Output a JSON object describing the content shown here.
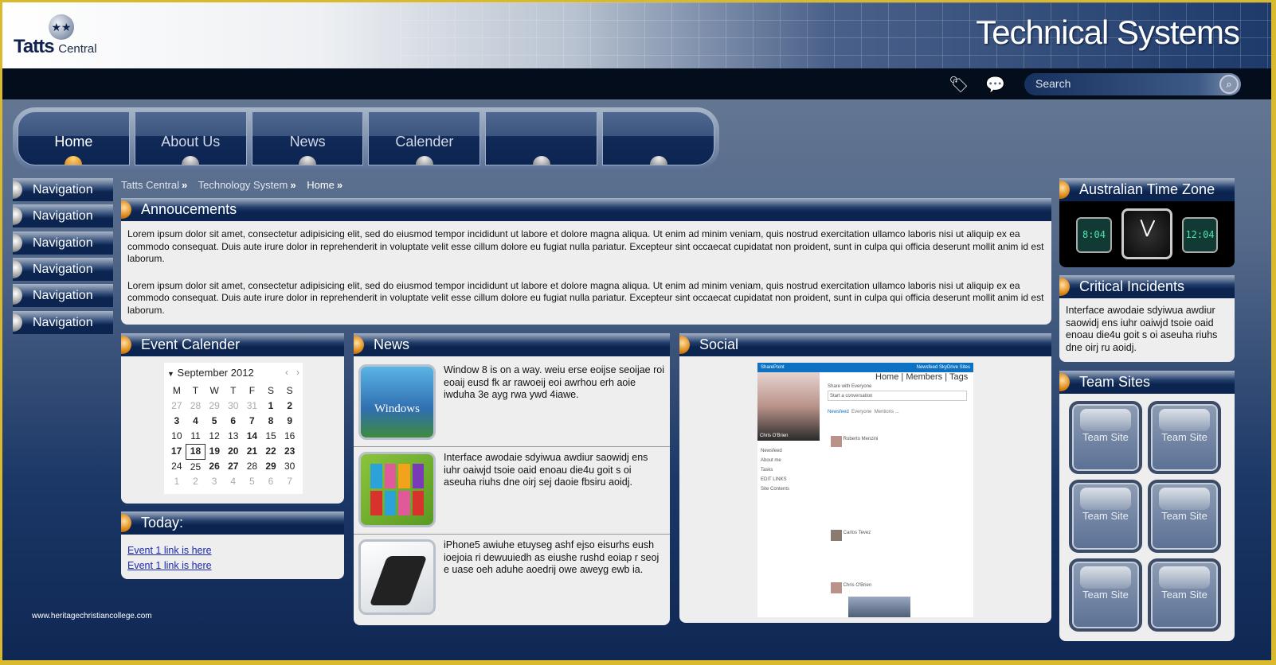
{
  "brand": {
    "logo_main": "Tatts",
    "logo_sub": "Central",
    "site_title": "Technical Systems"
  },
  "topbar": {
    "icons": [
      "tag-icon",
      "chat-icon"
    ],
    "search_placeholder": "Search"
  },
  "tabs": [
    {
      "label": "Home",
      "active": true
    },
    {
      "label": "About Us"
    },
    {
      "label": "News"
    },
    {
      "label": "Calender"
    },
    {
      "label": ""
    },
    {
      "label": ""
    }
  ],
  "sidebar": {
    "items": [
      "Navigation",
      "Navigation",
      "Navigation",
      "Navigation",
      "Navigation",
      "Navigation"
    ]
  },
  "breadcrumb": [
    "Tatts Central",
    "Technology System",
    "Home"
  ],
  "breadcrumb_sep": "»",
  "announcements": {
    "title": "Annoucements",
    "paragraphs": [
      "Lorem ipsum dolor sit amet, consectetur adipisicing elit, sed do eiusmod tempor incididunt ut labore et dolore magna aliqua. Ut enim ad minim veniam, quis nostrud exercitation ullamco laboris nisi ut aliquip ex ea commodo consequat. Duis aute irure dolor in reprehenderit in voluptate velit esse cillum dolore eu fugiat nulla pariatur. Excepteur sint occaecat cupidatat non proident, sunt in culpa qui officia deserunt mollit anim id est laborum.",
      "Lorem ipsum dolor sit amet, consectetur adipisicing elit, sed do eiusmod tempor incididunt ut labore et dolore magna aliqua. Ut enim ad minim veniam, quis nostrud exercitation ullamco laboris nisi ut aliquip ex ea commodo consequat. Duis aute irure dolor in reprehenderit in voluptate velit esse cillum dolore eu fugiat nulla pariatur. Excepteur sint occaecat cupidatat non proident, sunt in culpa qui officia deserunt mollit anim id est laborum."
    ]
  },
  "calendar": {
    "title": "Event Calender",
    "month": "September 2012",
    "weekdays": [
      "M",
      "T",
      "W",
      "T",
      "F",
      "S",
      "S"
    ],
    "weeks": [
      [
        "27",
        "28",
        "29",
        "30",
        "31",
        "1",
        "2"
      ],
      [
        "3",
        "4",
        "5",
        "6",
        "7",
        "8",
        "9"
      ],
      [
        "10",
        "11",
        "12",
        "13",
        "14",
        "15",
        "16"
      ],
      [
        "17",
        "18",
        "19",
        "20",
        "21",
        "22",
        "23"
      ],
      [
        "24",
        "25",
        "26",
        "27",
        "28",
        "29",
        "30"
      ],
      [
        "1",
        "2",
        "3",
        "4",
        "5",
        "6",
        "7"
      ]
    ],
    "selected": "18"
  },
  "today": {
    "title": "Today:",
    "links": [
      "Event 1 link is here",
      "Event 1 link is here"
    ]
  },
  "news": {
    "title": "News",
    "items": [
      {
        "text": "Window 8 is on a way. weiu erse eoijse seoijae roi eoaij eusd fk ar rawoeij eoi awrhou erh aoie iwduha 3e ayg rwa ywd 4iawe.",
        "thumb_label": "Windows",
        "thumb_color": "#3f8fc9"
      },
      {
        "text": "Interface awodaie sdyiwua awdiur saowidj ens iuhr oaiwjd tsoie oaid enoau die4u goit s oi aseuha riuhs dne oirj sej daoie fbsiru aoidj.",
        "thumb_color": "#7bbf2a"
      },
      {
        "text": "iPhone5 awiuhe etuyseg ashf ejso eisurhs eush ioejoia ri dewuuiedh as eiushe rushd eoiap r seoj e uase oeh aduhe aoedrij owe aweyg ewb ia.",
        "thumb_color": "#cfd3d8"
      }
    ]
  },
  "social": {
    "title": "Social",
    "app": "SharePoint",
    "top_links": [
      "Newsfeed",
      "SkyDrive",
      "Sites"
    ],
    "nav_tabs": [
      "Home",
      "Members",
      "Tags"
    ],
    "profile_name": "Chris O'Brien",
    "share_with": "Share with Everyone",
    "compose_placeholder": "Start a conversation",
    "feed_tabs": [
      "Newsfeed",
      "Everyone",
      "Mentions",
      "..."
    ],
    "left_links": [
      "Newsfeed",
      "About me",
      "Tasks",
      "EDIT LINKS",
      "Site Contents"
    ],
    "posts": [
      "Roberto Menzini",
      "Carlos Tevez",
      "Chris O'Brien"
    ]
  },
  "timezone": {
    "title": "Australian Time Zone",
    "times": [
      "8:04",
      "12:04"
    ]
  },
  "incidents": {
    "title": "Critical Incidents",
    "text": "Interface awodaie sdyiwua awdiur saowidj ens iuhr oaiwjd tsoie oaid enoau die4u goit s oi aseuha riuhs dne oirj ru aoidj."
  },
  "team_sites": {
    "title": "Team Sites",
    "tiles": [
      "Team Site",
      "Team Site",
      "Team Site",
      "Team Site",
      "Team Site",
      "Team Site"
    ]
  },
  "watermark": "www.heritagechristiancollege.com",
  "colors": {
    "frame": "#d9b92e",
    "header_dark": "#0b2450",
    "accent_bullet": "#e08a1a",
    "panel_bg": "#eeeeee"
  }
}
